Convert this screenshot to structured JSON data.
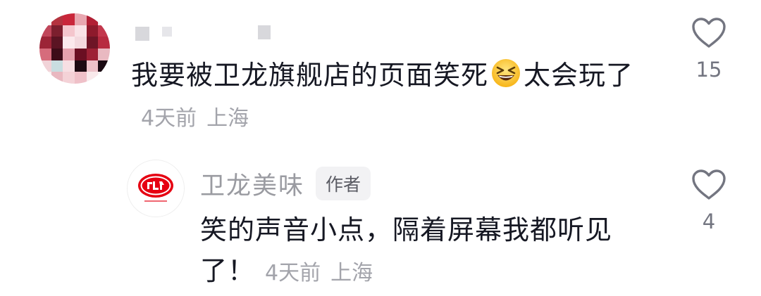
{
  "main_comment": {
    "text": "我要被卫龙旗舰店的页面笑死",
    "emoji": "grinning-squinting-face",
    "text_after_emoji": "太会玩了",
    "time": "4天前",
    "location": "上海",
    "like_count": "15"
  },
  "reply": {
    "author_name": "卫龙美味",
    "author_badge": "作者",
    "text": "笑的声音小点，隔着屏幕我都听见了！",
    "time": "4天前",
    "location": "上海",
    "like_count": "4"
  },
  "colors": {
    "text": "#161823",
    "meta": "#a3a4ab",
    "author_name": "#9a9ba1",
    "badge_bg": "#f2f2f4",
    "like_icon": "#737580",
    "logo_red": "#e60012"
  },
  "icons": {
    "like": "heart-outline-icon",
    "emoji": "grinning-squinting-face-emoji"
  }
}
